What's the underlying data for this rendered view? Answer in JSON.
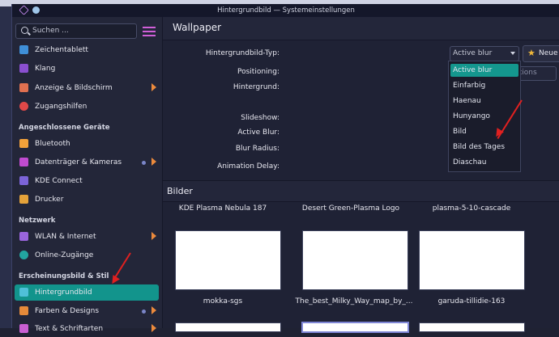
{
  "window": {
    "title": "Hintergrundbild — Systemeinstellungen"
  },
  "sidebar": {
    "search_placeholder": "Suchen ...",
    "items": [
      {
        "label": "Zeichentablett",
        "icon": "tablet-icon",
        "color": "#3f8fd8"
      },
      {
        "label": "Klang",
        "icon": "speaker-icon",
        "color": "#8a4fd0"
      },
      {
        "label": "Anzeige & Bildschirm",
        "icon": "monitor-icon",
        "color": "#e07050"
      },
      {
        "label": "Zugangshilfen",
        "icon": "accessibility-icon",
        "color": "#e04848"
      }
    ],
    "section_devices": "Angeschlossene Geräte",
    "devices": [
      {
        "label": "Bluetooth",
        "icon": "bluetooth-icon",
        "color": "#f2a13a"
      },
      {
        "label": "Datenträger & Kameras",
        "icon": "drive-icon",
        "color": "#c04bd0"
      },
      {
        "label": "KDE Connect",
        "icon": "phone-icon",
        "color": "#7c64d8"
      },
      {
        "label": "Drucker",
        "icon": "printer-icon",
        "color": "#e5a23a"
      }
    ],
    "section_network": "Netzwerk",
    "network": [
      {
        "label": "WLAN & Internet",
        "icon": "wifi-icon",
        "color": "#9a65dd"
      },
      {
        "label": "Online-Zugänge",
        "icon": "online-accounts-icon",
        "color": "#22a5a0"
      }
    ],
    "section_appearance": "Erscheinungsbild & Stil",
    "appearance": [
      {
        "label": "Hintergrundbild",
        "icon": "wallpaper-icon",
        "color": "#4fc0d8"
      },
      {
        "label": "Farben & Designs",
        "icon": "palette-icon",
        "color": "#e58a3a"
      },
      {
        "label": "Text & Schriftarten",
        "icon": "font-icon",
        "color": "#c95fd3"
      }
    ]
  },
  "main": {
    "title": "Wallpaper",
    "fields": {
      "type_label": "Hintergrundbild-Typ:",
      "type_value": "Active blur",
      "new_button": "Neue Moti",
      "positioning_label": "Positioning:",
      "background_label": "Hintergrund:",
      "slideshow_label": "Slideshow:",
      "active_blur_label": "Active Blur:",
      "blur_radius_label": "Blur Radius:",
      "animation_delay_label": "Animation Delay:",
      "partial_text": "rtions"
    },
    "dropdown_options": [
      "Active blur",
      "Einfarbig",
      "Haenau",
      "Hunyango",
      "Bild",
      "Bild des Tages",
      "Diaschau"
    ],
    "bilder_title": "Bilder",
    "wallpapers_row1": [
      "KDE Plasma Nebula 187",
      "Desert Green-Plasma Logo",
      "plasma-5-10-cascade"
    ],
    "wallpapers_row2": [
      "mokka-sgs",
      "The_best_Milky_Way_map_by_...",
      "garuda-tillidie-163"
    ]
  },
  "colors": {
    "accent": "#14978e",
    "annotation_arrow": "#e02020",
    "chevron": "#ec8a3c"
  }
}
